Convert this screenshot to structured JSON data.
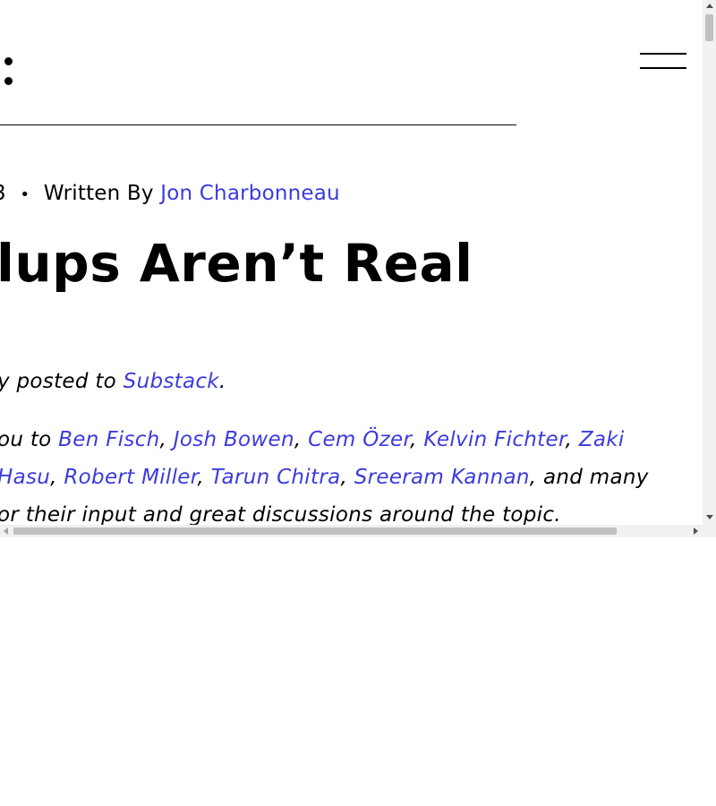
{
  "header": {
    "logo_icon": "colon-logo-icon",
    "menu_icon": "hamburger-menu-icon"
  },
  "meta": {
    "date_fragment": "3",
    "separator": "•",
    "written_by_label": "Written By",
    "author": "Jon Charbonneau"
  },
  "article": {
    "title": "lups Aren’t Real",
    "intro": {
      "prefix": "y posted to ",
      "link": "Substack",
      "suffix": "."
    },
    "thanks_line1": {
      "prefix": "ou to ",
      "names": [
        "Ben Fisch",
        "Josh Bowen",
        "Cem Özer",
        "Kelvin Fichter",
        "Zaki"
      ],
      "separator": ", "
    },
    "thanks_line2": {
      "names": [
        "Hasu",
        "Robert Miller",
        "Tarun Chitra",
        "Sreeram Kannan"
      ],
      "separator": ", ",
      "suffix": ", and many"
    },
    "thanks_line3": "or their input and great discussions around the topic."
  },
  "colors": {
    "link": "#3b3bdf",
    "text": "#000000",
    "background": "#ffffff",
    "scrollbar_track": "#f1f1f1",
    "scrollbar_thumb": "#c1c1c1"
  }
}
